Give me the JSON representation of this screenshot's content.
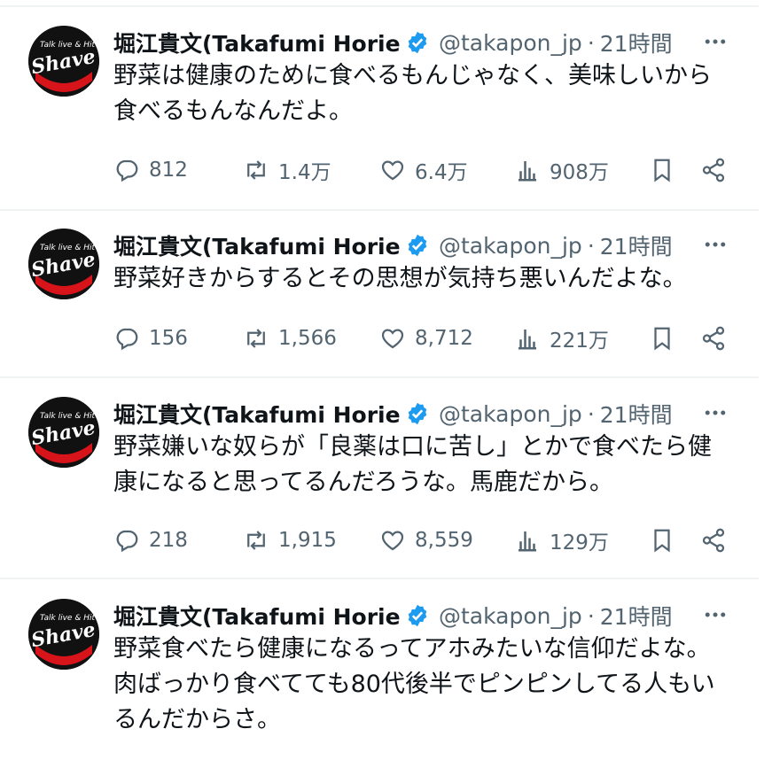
{
  "tweets": [
    {
      "name": "堀江貴文(Takafumi Horie)",
      "handle": "@takapon_jp",
      "dot": "·",
      "time": "21時間",
      "text": "野菜は健康のために食べるもんじゃなく、美味しいから食べるもんなんだよ。",
      "replies": "812",
      "retweets": "1.4万",
      "likes": "6.4万",
      "views": "908万"
    },
    {
      "name": "堀江貴文(Takafumi Horie)",
      "handle": "@takapon_jp",
      "dot": "·",
      "time": "21時間",
      "text": "野菜好きからするとその思想が気持ち悪いんだよな。",
      "replies": "156",
      "retweets": "1,566",
      "likes": "8,712",
      "views": "221万"
    },
    {
      "name": "堀江貴文(Takafumi Horie)",
      "handle": "@takapon_jp",
      "dot": "·",
      "time": "21時間",
      "text": "野菜嫌いな奴らが「良薬は口に苦し」とかで食べたら健康になると思ってるんだろうな。馬鹿だから。",
      "replies": "218",
      "retweets": "1,915",
      "likes": "8,559",
      "views": "129万"
    },
    {
      "name": "堀江貴文(Takafumi Horie)",
      "handle": "@takapon_jp",
      "dot": "·",
      "time": "21時間",
      "text": "野菜食べたら健康になるってアホみたいな信仰だよな。肉ばっかり食べてても80代後半でピンピンしてる人もいるんだからさ。"
    }
  ],
  "avatar_text": "Shave",
  "avatar_subtext": "Talk live & Hit",
  "icons": [
    "verified-badge-icon",
    "more-icon",
    "reply-icon",
    "retweet-icon",
    "like-icon",
    "views-icon",
    "bookmark-icon",
    "share-icon"
  ],
  "colors": {
    "verified": "#1d9bf0",
    "muted": "#536471",
    "separator": "#eff3f4",
    "avatar_red": "#d7141a"
  }
}
